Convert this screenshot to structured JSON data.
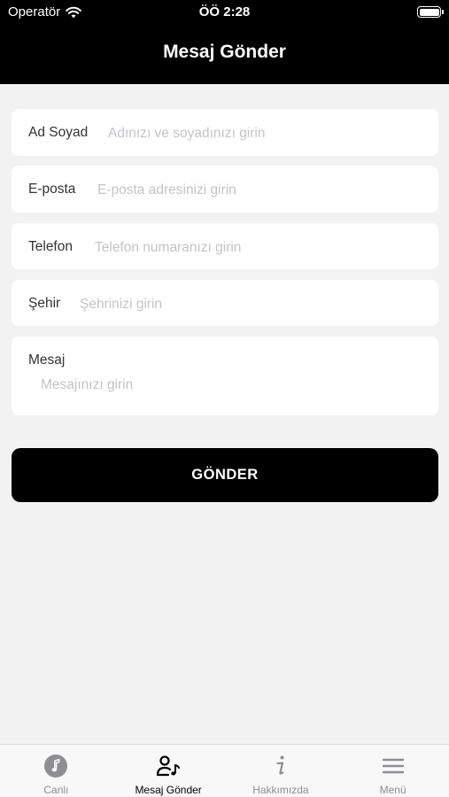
{
  "status_bar": {
    "carrier": "Operatör",
    "time": "ÖÖ 2:28",
    "battery_level": 1.0
  },
  "header": {
    "title": "Mesaj Gönder"
  },
  "form": {
    "name": {
      "label": "Ad Soyad",
      "placeholder": "Adınızı ve soyadınızı girin"
    },
    "email": {
      "label": "E-posta",
      "placeholder": "E-posta adresinizi girin"
    },
    "phone": {
      "label": "Telefon",
      "placeholder": "Telefon numaranızı girin"
    },
    "city": {
      "label": "Şehir",
      "placeholder": "Şehrinizi girin"
    },
    "message": {
      "label": "Mesaj",
      "placeholder": "Mesajınızı girin"
    },
    "submit_label": "GÖNDER"
  },
  "tabbar": {
    "tabs": [
      {
        "label": "Canlı",
        "icon": "music-note-icon",
        "active": false
      },
      {
        "label": "Mesaj Gönder",
        "icon": "person-music-icon",
        "active": true
      },
      {
        "label": "Hakkımızda",
        "icon": "info-icon",
        "active": false
      },
      {
        "label": "Menü",
        "icon": "menu-icon",
        "active": false
      }
    ]
  },
  "colors": {
    "header_bg": "#000000",
    "page_bg": "#f2f2f2",
    "placeholder": "#c4c4c8",
    "tab_inactive": "#8e8e93"
  }
}
